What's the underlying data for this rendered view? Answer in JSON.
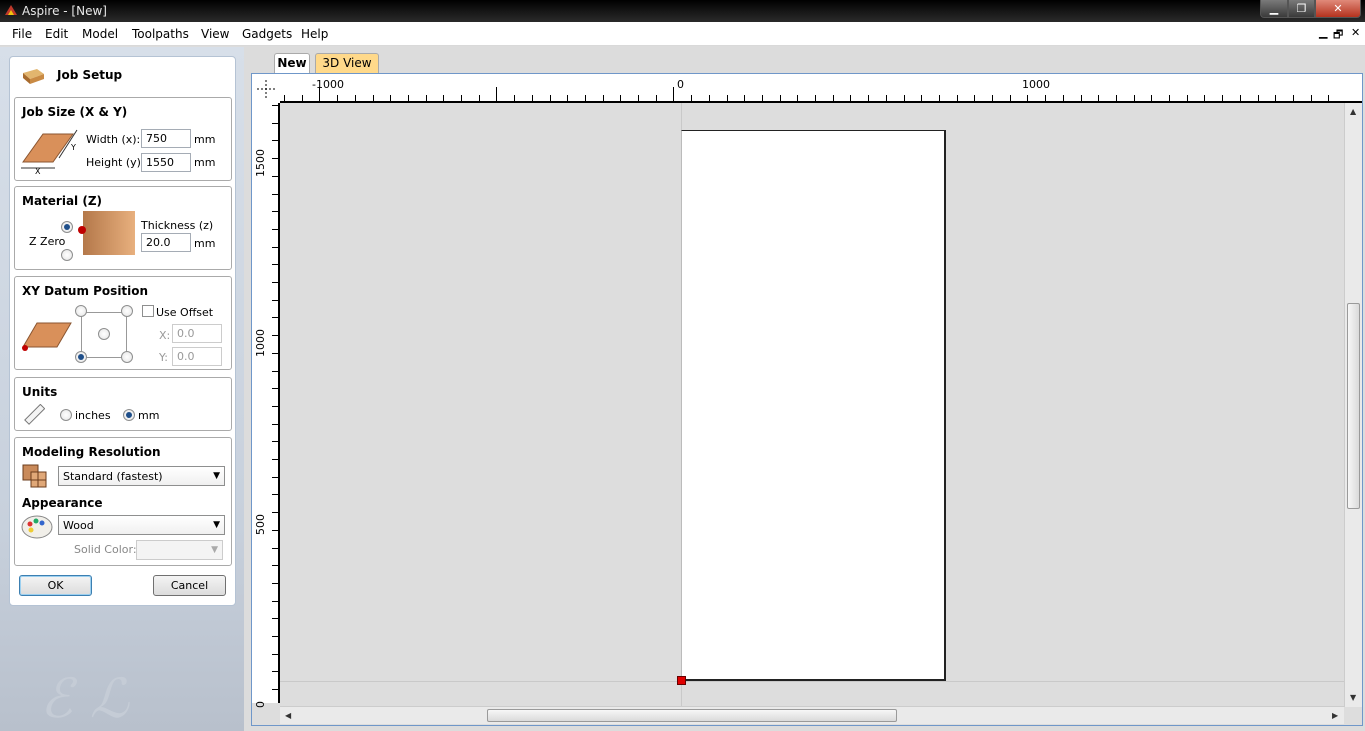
{
  "window": {
    "title": "Aspire - [New]",
    "min": "▁",
    "max": "❐",
    "close": "✕"
  },
  "menu": [
    "File",
    "Edit",
    "Model",
    "Toolpaths",
    "View",
    "Gadgets",
    "Help"
  ],
  "mdi_controls": {
    "min": "▁",
    "restore": "🗗",
    "close": "✕"
  },
  "panel": {
    "title": "Job Setup",
    "job_size": {
      "heading": "Job Size (X & Y)",
      "width_label": "Width (x):",
      "width_value": "750",
      "width_unit": "mm",
      "height_label": "Height (y):",
      "height_value": "1550",
      "height_unit": "mm",
      "axis_x": "X",
      "axis_y": "Y"
    },
    "material": {
      "heading": "Material (Z)",
      "zzero_label": "Z Zero",
      "thickness_label": "Thickness (z)",
      "thickness_value": "20.0",
      "thickness_unit": "mm",
      "zzero_selected": "top"
    },
    "datum": {
      "heading": "XY Datum Position",
      "use_offset": "Use Offset",
      "x_label": "X:",
      "x_value": "0.0",
      "y_label": "Y:",
      "y_value": "0.0",
      "selected": "bottom-left"
    },
    "units": {
      "heading": "Units",
      "inches": "inches",
      "mm": "mm",
      "selected": "mm"
    },
    "resolution": {
      "heading": "Modeling Resolution",
      "value": "Standard (fastest)"
    },
    "appearance": {
      "heading": "Appearance",
      "value": "Wood",
      "solid_color_label": "Solid Color:"
    },
    "ok": "OK",
    "cancel": "Cancel"
  },
  "tabs": [
    {
      "label": "New",
      "active": true
    },
    {
      "label": "3D View",
      "active": false
    }
  ],
  "rulers": {
    "h_labels": [
      "-1000",
      "0",
      "1000"
    ],
    "v_labels": [
      "1500",
      "1000",
      "500",
      "0"
    ]
  },
  "colors": {
    "origin": "#e00000",
    "tab_3d": "#ffd98a",
    "view_border": "#6f97c9"
  }
}
